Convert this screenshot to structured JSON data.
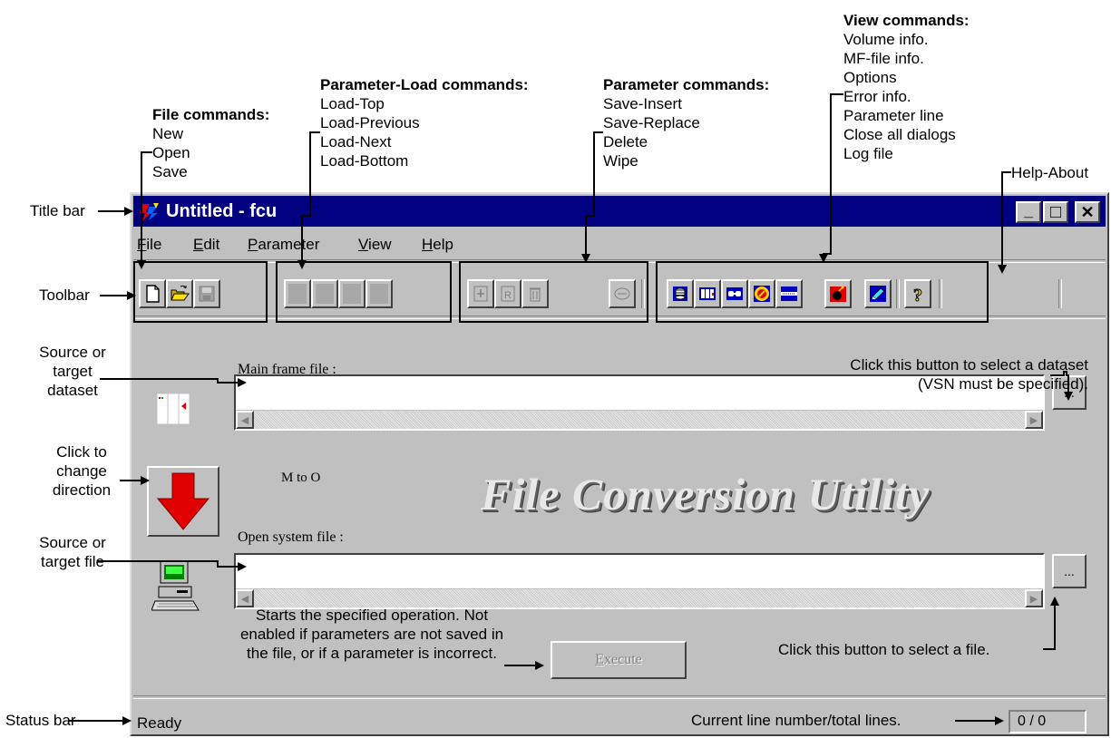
{
  "annotations": {
    "file_commands": {
      "title": "File commands:",
      "items": [
        "New",
        "Open",
        "Save"
      ]
    },
    "param_load_commands": {
      "title": "Parameter-Load commands:",
      "items": [
        "Load-Top",
        "Load-Previous",
        "Load-Next",
        "Load-Bottom"
      ]
    },
    "param_commands": {
      "title": "Parameter commands:",
      "items": [
        "Save-Insert",
        "Save-Replace",
        "Delete",
        "Wipe"
      ]
    },
    "view_commands": {
      "title": "View commands:",
      "items": [
        "Volume info.",
        "MF-file info.",
        "Options",
        "Error info.",
        "Parameter line",
        "Close all dialogs",
        "Log file"
      ]
    },
    "help_about": "Help-About",
    "title_bar": "Title bar",
    "toolbar": "Toolbar",
    "source_dataset": [
      "Source or",
      "target",
      "dataset"
    ],
    "click_direction": [
      "Click to",
      "change",
      "direction"
    ],
    "source_file": [
      "Source or",
      "target file"
    ],
    "select_dataset": [
      "Click this button to select a dataset",
      "(VSN must be specified)."
    ],
    "select_file": "Click this button to select a file.",
    "execute_note": [
      "Starts the specified operation. Not",
      "enabled if parameters are not saved in",
      "the file, or if a parameter is incorrect."
    ],
    "status_bar": "Status bar",
    "line_numbers": "Current line number/total lines."
  },
  "window": {
    "title": "Untitled - fcu",
    "controls": {
      "minimize": "_",
      "maximize": "□",
      "close": "✕"
    }
  },
  "menu": [
    {
      "pre": "",
      "u": "F",
      "post": "ile"
    },
    {
      "pre": "",
      "u": "E",
      "post": "dit"
    },
    {
      "pre": "",
      "u": "P",
      "post": "arameter"
    },
    {
      "pre": "",
      "u": "V",
      "post": "iew"
    },
    {
      "pre": "",
      "u": "H",
      "post": "elp"
    }
  ],
  "toolbar_icons": [
    "new-icon",
    "open-icon",
    "save-icon",
    "load-top-icon",
    "load-previous-icon",
    "load-next-icon",
    "load-bottom-icon",
    "save-insert-icon",
    "save-replace-icon",
    "delete-icon",
    "wipe-icon",
    "volume-info-icon",
    "mf-file-info-icon",
    "options-icon",
    "error-info-icon",
    "parameter-line-icon",
    "log-file-icon",
    "close-dialogs-icon",
    "help-about-icon"
  ],
  "main": {
    "mf_label": "Main frame file :",
    "mf_value": "",
    "os_label": "Open system file :",
    "os_value": "",
    "browse_label": "...",
    "direction": "M to O",
    "banner": "File Conversion Utility",
    "execute_label": "Execute",
    "execute_accel": "E",
    "execute_rest": "xecute"
  },
  "status": {
    "text": "Ready",
    "lines": "0 / 0"
  },
  "colors": {
    "title_bg": "#000080",
    "face": "#c0c0c0",
    "arrow": "#e00000"
  }
}
